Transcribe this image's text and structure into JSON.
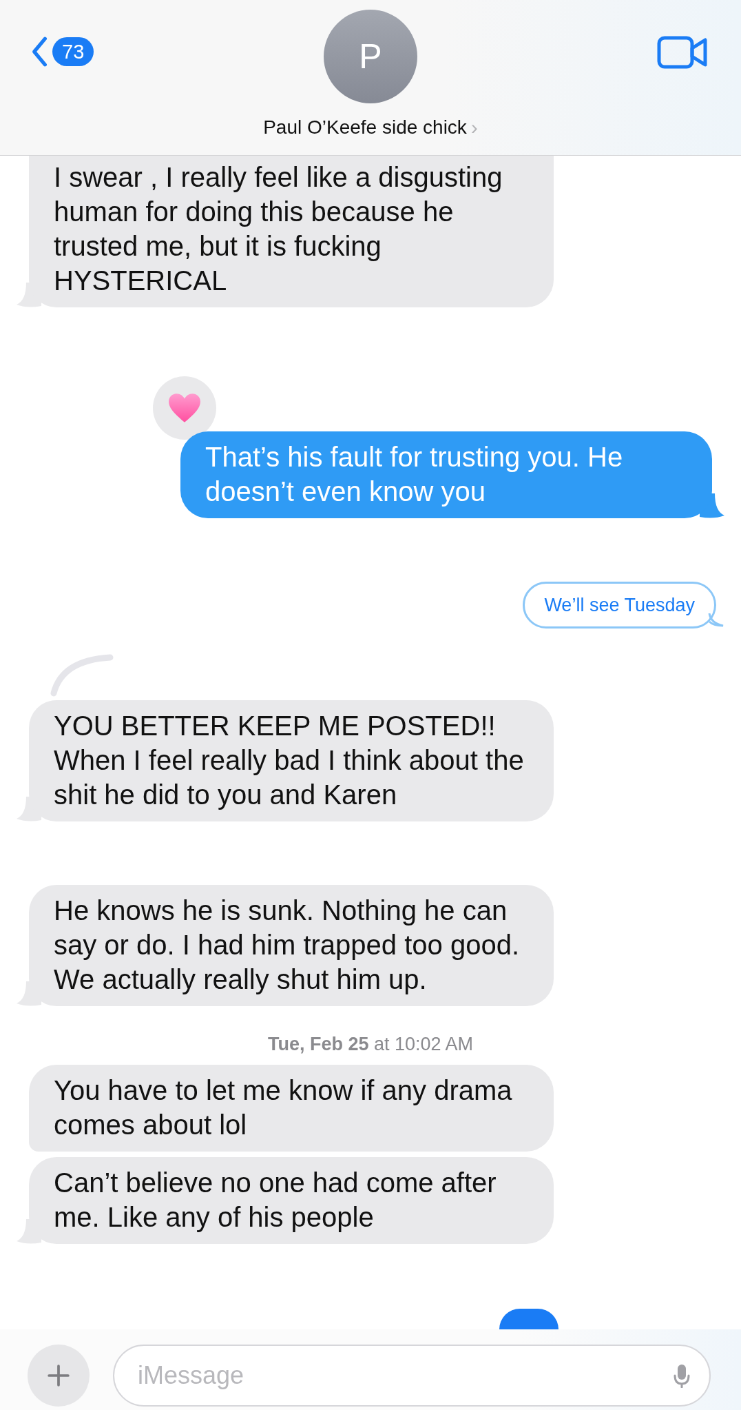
{
  "header": {
    "back_count": "73",
    "avatar_initial": "P",
    "contact_name": "Paul O’Keefe side chick",
    "chevron": "›"
  },
  "messages": [
    {
      "kind": "received",
      "text": "I swear , I really feel like a disgusting human for doing this because he trusted me, but it is fucking HYSTERICAL",
      "tail": true
    },
    {
      "kind": "sent",
      "text": "That’s his fault for trusting you. He doesn’t even know you",
      "tail": true,
      "tapback": true
    },
    {
      "kind": "outlined",
      "text": "We’ll see Tuesday",
      "tail": true
    },
    {
      "kind": "received",
      "text": "YOU BETTER KEEP ME POSTED!! When I feel really bad I think about the shit he did to you and Karen",
      "tail": true,
      "reply_thread": true
    },
    {
      "kind": "received",
      "text": "He knows he is sunk. Nothing he can say or do. I had him trapped too good. We actually really shut him up.",
      "tail": true
    },
    {
      "kind": "timestamp",
      "text": "**Tue, Feb 25** at 10:02 AM"
    },
    {
      "kind": "received",
      "text": "You have to let me know if any drama comes about lol",
      "tail": false
    },
    {
      "kind": "received",
      "text": "Can’t believe no one had come after me.  Like any of his people",
      "tail": true
    }
  ],
  "composer": {
    "placeholder": "iMessage"
  }
}
